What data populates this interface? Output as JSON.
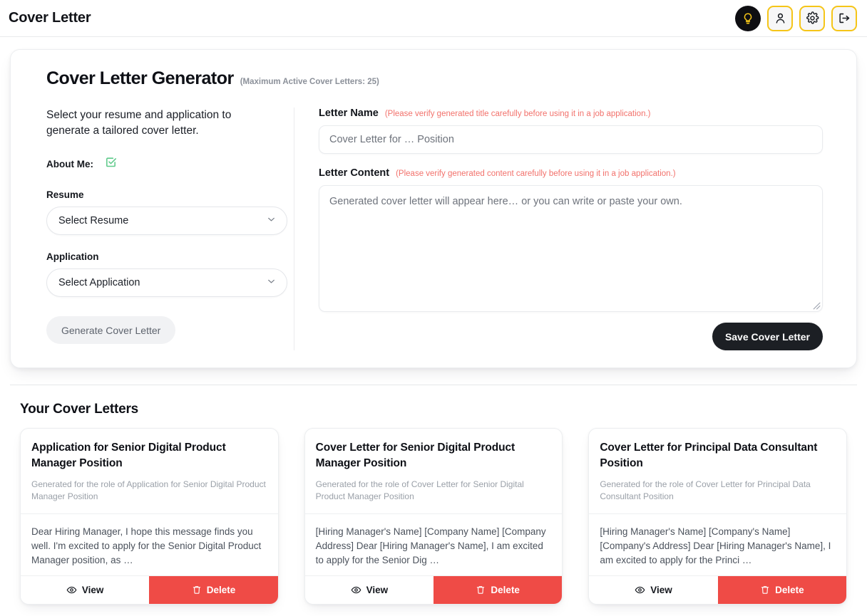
{
  "header": {
    "title": "Cover Letter",
    "actions": [
      {
        "name": "tips-lightbulb-button",
        "icon": "lightbulb-icon"
      },
      {
        "name": "profile-button",
        "icon": "user-icon"
      },
      {
        "name": "settings-button",
        "icon": "gear-icon"
      },
      {
        "name": "logout-button",
        "icon": "logout-icon"
      }
    ],
    "accent_yellow": "#f5c518",
    "bulb_bg": "#0e0e12"
  },
  "generator": {
    "title": "Cover Letter Generator",
    "subtitle": "(Maximum Active Cover Letters: 25)",
    "lead": "Select your resume and application to generate a tailored cover letter.",
    "about_me_label": "About Me:",
    "about_me_icon": "check-square-icon",
    "about_me_color": "#5ec98a",
    "resume_label": "Resume",
    "resume_value": "Select Resume",
    "application_label": "Application",
    "application_value": "Select Application",
    "generate_button": "Generate Cover Letter",
    "letter_name_label": "Letter Name",
    "letter_name_warning": "(Please verify generated title carefully before using it in a job application.)",
    "letter_name_placeholder": "Cover Letter for … Position",
    "letter_name_value": "",
    "letter_content_label": "Letter Content",
    "letter_content_warning": "(Please verify generated content carefully before using it in a job application.)",
    "letter_content_placeholder": "Generated cover letter will appear here… or you can write or paste your own.",
    "letter_content_value": "",
    "save_button": "Save Cover Letter",
    "warning_color": "#f2716b"
  },
  "list": {
    "title": "Your Cover Letters",
    "view_label": "View",
    "delete_label": "Delete",
    "delete_color": "#ef4b46",
    "cards": [
      {
        "title": "Application for Senior Digital Product Manager Position",
        "meta": "Generated for the role of Application for Senior Digital Product Manager Position",
        "preview": "Dear Hiring Manager, I hope this message finds you well. I'm excited to apply for the Senior Digital Product Manager position, as …"
      },
      {
        "title": "Cover Letter for Senior Digital Product Manager Position",
        "meta": "Generated for the role of Cover Letter for Senior Digital Product Manager Position",
        "preview": "[Hiring Manager's Name] [Company Name] [Company Address] Dear [Hiring Manager's Name], I am excited to apply for the Senior Dig …"
      },
      {
        "title": "Cover Letter for Principal Data Consultant Position",
        "meta": "Generated for the role of Cover Letter for Principal Data Consultant Position",
        "preview": "[Hiring Manager's Name] [Company's Name] [Company's Address] Dear [Hiring Manager's Name], I am excited to apply for the Princi …"
      }
    ]
  }
}
